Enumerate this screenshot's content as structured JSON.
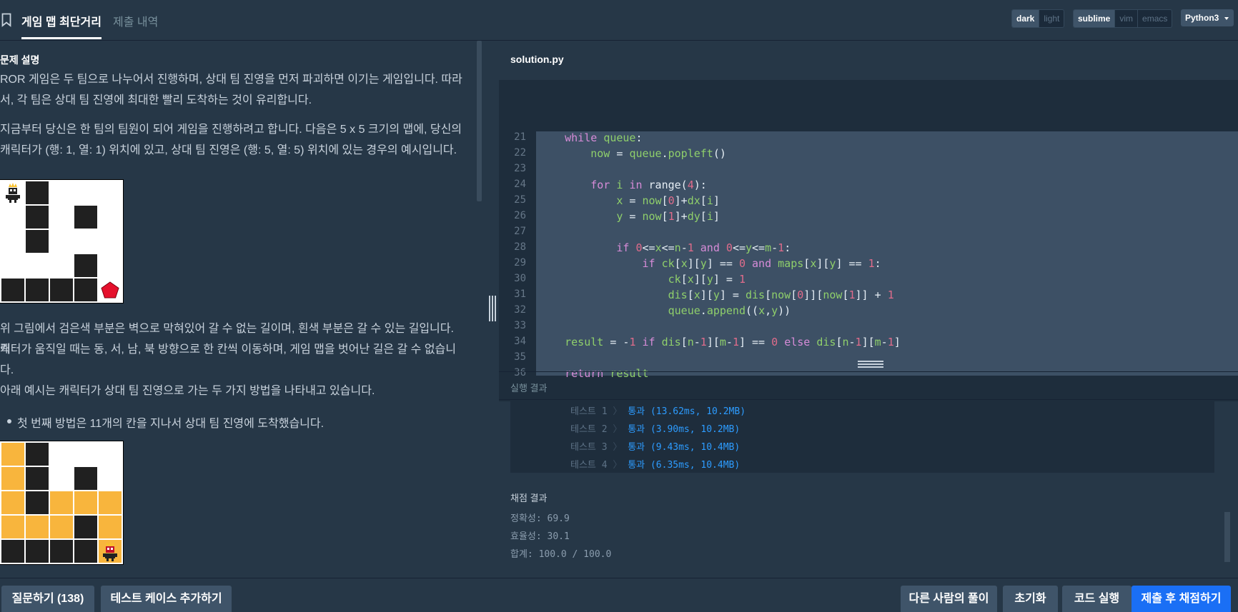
{
  "tabs": {
    "description": "게임 맵 최단거리",
    "history": "제출 내역"
  },
  "theme": {
    "dark": "dark",
    "light": "light",
    "selected": "dark"
  },
  "keymap": {
    "sublime": "sublime",
    "vim": "vim",
    "emacs": "emacs",
    "selected": "sublime"
  },
  "language": "Python3",
  "problem": {
    "heading": "문제 설명",
    "p1a": "ROR 게임은 두 팀으로 나누어서 진행하며, 상대 팀 진영을 먼저 파괴하면 이기는 게임입니다. 따라",
    "p1b": "서, 각 팀은 상대 팀 진영에 최대한 빨리 도착하는 것이 유리합니다.",
    "p2a": "지금부터 당신은 한 팀의 팀원이 되어 게임을 진행하려고 합니다. 다음은 5 x 5 크기의 맵에, 당신의",
    "p2b": "캐릭터가 (행: 1, 열: 1) 위치에 있고, 상대 팀 진영은 (행: 5, 열: 5) 위치에 있는 경우의 예시입니다.",
    "p3a": "위 그림에서 검은색 부분은 벽으로 막혀있어 갈 수 없는 길이며, 흰색 부분은 갈 수 있는 길입니다. 캐",
    "p3b": "릭터가 움직일 때는 동, 서, 남, 북 방향으로 한 칸씩 이동하며, 게임 맵을 벗어난 길은 갈 수 없습니",
    "p3c": "다.",
    "p4": "아래 예시는 캐릭터가 상대 팀 진영으로 가는 두 가지 방법을 나타내고 있습니다.",
    "bullet1": "첫 번째 방법은 11개의 칸을 지나서 상대 팀 진영에 도착했습니다."
  },
  "map1": [
    [
      0,
      1,
      0,
      0,
      0
    ],
    [
      0,
      1,
      0,
      1,
      0
    ],
    [
      0,
      1,
      0,
      0,
      0
    ],
    [
      0,
      0,
      0,
      1,
      0
    ],
    [
      1,
      1,
      1,
      1,
      0
    ]
  ],
  "map2": [
    [
      2,
      1,
      0,
      0,
      0
    ],
    [
      2,
      1,
      0,
      1,
      0
    ],
    [
      2,
      1,
      2,
      2,
      2
    ],
    [
      2,
      2,
      2,
      1,
      2
    ],
    [
      1,
      1,
      1,
      1,
      2
    ]
  ],
  "editor": {
    "filename": "solution.py",
    "line_numbers": [
      "21",
      "22",
      "23",
      "24",
      "25",
      "26",
      "27",
      "28",
      "29",
      "30",
      "31",
      "32",
      "33",
      "34",
      "35",
      "36"
    ]
  },
  "results": {
    "title": "실행 결과",
    "tests": [
      {
        "label": "테스트 1",
        "sep": "〉",
        "value": "통과 (13.62ms, 10.2MB)"
      },
      {
        "label": "테스트 2",
        "sep": "〉",
        "value": "통과 (3.90ms, 10.2MB)"
      },
      {
        "label": "테스트 3",
        "sep": "〉",
        "value": "통과 (9.43ms, 10.4MB)"
      },
      {
        "label": "테스트 4",
        "sep": "〉",
        "value": "통과 (6.35ms, 10.4MB)"
      }
    ],
    "grade_title": "채점 결과",
    "accuracy": "정확성: 69.9",
    "efficiency": "효율성: 30.1",
    "total": "합계: 100.0 / 100.0"
  },
  "buttons": {
    "question": "질문하기 (138)",
    "add_testcase": "테스트 케이스 추가하기",
    "others": "다른 사람의 풀이",
    "reset": "초기화",
    "run": "코드 실행",
    "submit": "제출 후 채점하기"
  },
  "colors": {
    "background": "#263747",
    "editor": "#1e2d3c",
    "selection": "#3d5065",
    "primary": "#1a6ff5",
    "path": "#f8b53d",
    "pass": "#2d9cff"
  }
}
